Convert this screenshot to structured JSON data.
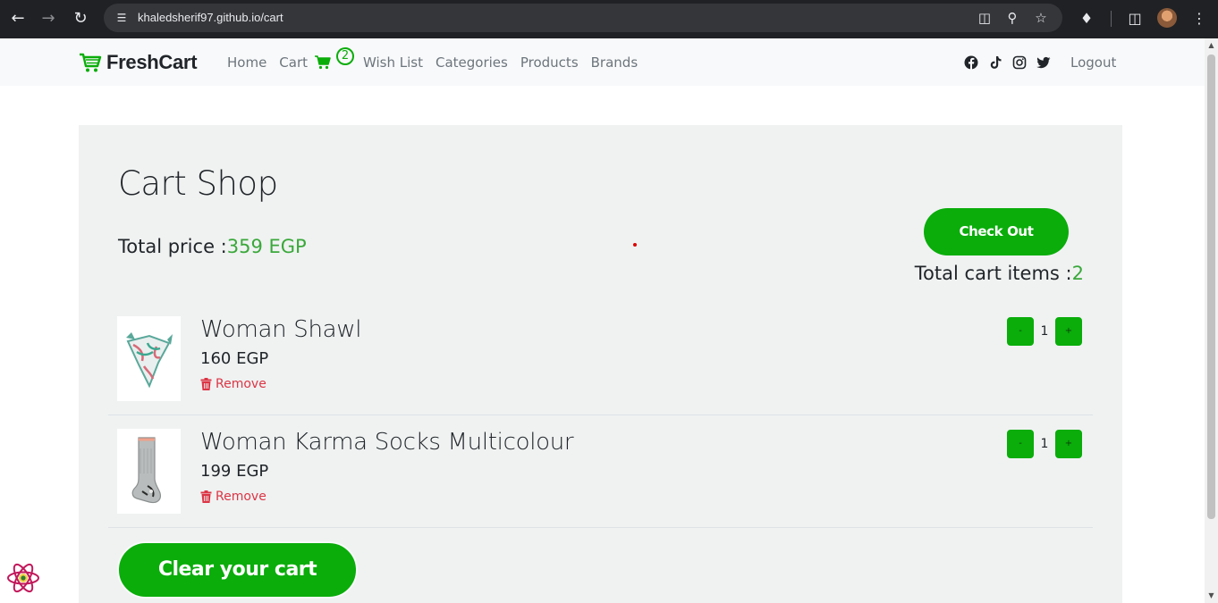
{
  "browser": {
    "url": "khaledsherif97.github.io/cart",
    "back_icon": "arrow-left-icon",
    "forward_icon": "arrow-right-icon",
    "reload_icon": "reload-icon"
  },
  "navbar": {
    "brand": "FreshCart",
    "links": {
      "home": "Home",
      "cart": "Cart",
      "wishlist": "Wish List",
      "categories": "Categories",
      "products": "Products",
      "brands": "Brands"
    },
    "cart_badge": "2",
    "logout": "Logout",
    "socials": [
      "facebook-icon",
      "tiktok-icon",
      "instagram-icon",
      "twitter-icon"
    ]
  },
  "cart": {
    "title": "Cart Shop",
    "total_price_label": "Total price :",
    "total_price_value": "359 EGP",
    "checkout_label": "Check Out",
    "total_items_label": "Total cart items :",
    "total_items_value": "2",
    "remove_label": "Remove",
    "decrement_label": "-",
    "increment_label": "+",
    "items": [
      {
        "name": "Woman Shawl",
        "price": "160 EGP",
        "quantity": "1"
      },
      {
        "name": "Woman Karma Socks Multicolour",
        "price": "199 EGP",
        "quantity": "1"
      }
    ],
    "clear_label": "Clear your cart"
  },
  "colors": {
    "accent": "#0aad0a",
    "price_green": "#3aa83a",
    "remove_red": "#dc3545",
    "box_bg": "#f0f2f2"
  }
}
